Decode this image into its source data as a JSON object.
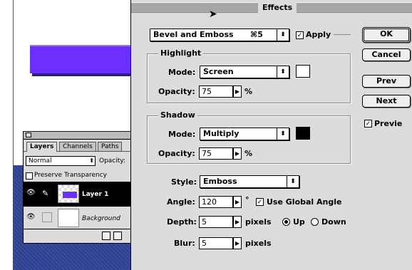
{
  "dialog": {
    "title": "Effects",
    "effect_select": {
      "value": "Bevel and Emboss",
      "shortcut": "⌘5"
    },
    "apply": {
      "label": "Apply",
      "checked": true
    },
    "buttons": {
      "ok": "OK",
      "cancel": "Cancel",
      "prev": "Prev",
      "next": "Next"
    },
    "preview": {
      "label": "Previe",
      "checked": true
    },
    "highlight": {
      "title": "Highlight",
      "mode_label": "Mode:",
      "mode_value": "Screen",
      "opacity_label": "Opacity:",
      "opacity_value": "75",
      "percent": "%",
      "color": "#ffffff"
    },
    "shadow": {
      "title": "Shadow",
      "mode_label": "Mode:",
      "mode_value": "Multiply",
      "opacity_label": "Opacity:",
      "opacity_value": "75",
      "percent": "%",
      "color": "#000000"
    },
    "style": {
      "label": "Style:",
      "value": "Emboss"
    },
    "angle": {
      "label": "Angle:",
      "value": "120",
      "unit": "°",
      "global_label": "Use Global Angle",
      "global_checked": true
    },
    "depth": {
      "label": "Depth:",
      "value": "5",
      "unit": "pixels",
      "up_label": "Up",
      "down_label": "Down",
      "direction": "Up"
    },
    "blur": {
      "label": "Blur:",
      "value": "5",
      "unit": "pixels"
    }
  },
  "layers_palette": {
    "tabs": [
      "Layers",
      "Channels",
      "Paths"
    ],
    "blend_mode": "Normal",
    "opacity_label": "Opacity:",
    "preserve_transparency": "Preserve Transparency",
    "layers": [
      {
        "name": "Layer 1",
        "selected": true
      },
      {
        "name": "Background",
        "selected": false
      }
    ]
  },
  "colors": {
    "accent": "#6b30ff",
    "desktop": "#34468f"
  }
}
